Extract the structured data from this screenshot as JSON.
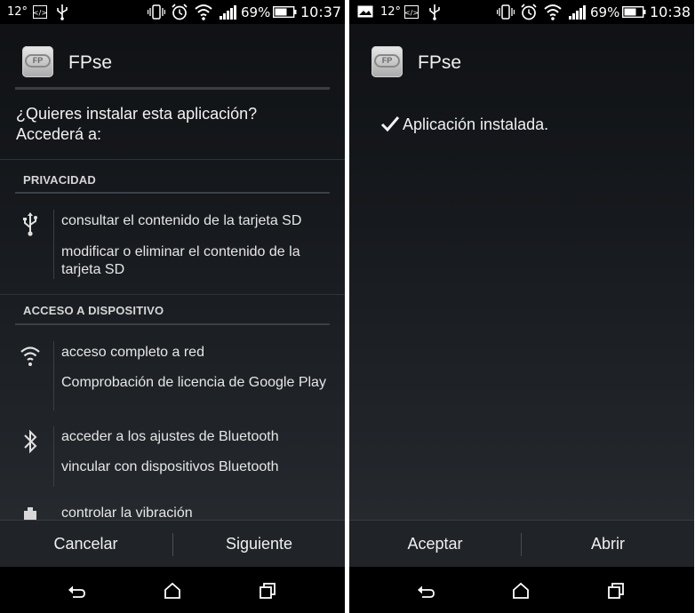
{
  "left": {
    "status": {
      "temp": "12°",
      "battery_pct": "69%",
      "time": "10:37"
    },
    "app_name": "FPse",
    "question_line1": "¿Quieres instalar esta aplicación?",
    "question_line2": "Accederá a:",
    "sections": [
      {
        "title": "PRIVACIDAD"
      },
      {
        "title": "ACCESO A DISPOSITIVO"
      }
    ],
    "perms": {
      "sd_read": "consultar el contenido de la tarjeta SD",
      "sd_write": "modificar o eliminar el contenido de la tarjeta SD",
      "net_full": "acceso completo a red",
      "license": "Comprobación de licencia de Google Play",
      "bt_settings": "acceder a los ajustes de Bluetooth",
      "bt_pair": "vincular con dispositivos Bluetooth",
      "vibrate": "controlar la vibración"
    },
    "buttons": {
      "cancel": "Cancelar",
      "next": "Siguiente"
    }
  },
  "right": {
    "status": {
      "temp": "12°",
      "battery_pct": "69%",
      "time": "10:38"
    },
    "app_name": "FPse",
    "installed_text": "Aplicación instalada.",
    "buttons": {
      "accept": "Aceptar",
      "open": "Abrir"
    }
  },
  "icons": [
    "usb-icon",
    "wifi-icon",
    "bluetooth-icon",
    "vibration-icon",
    "back-icon",
    "home-icon",
    "recents-icon",
    "check-icon",
    "alarm-icon",
    "signal-icon",
    "battery-icon"
  ],
  "colors": {
    "background": "#16191d",
    "status_bar": "#000000",
    "button_bar": "#202327"
  }
}
